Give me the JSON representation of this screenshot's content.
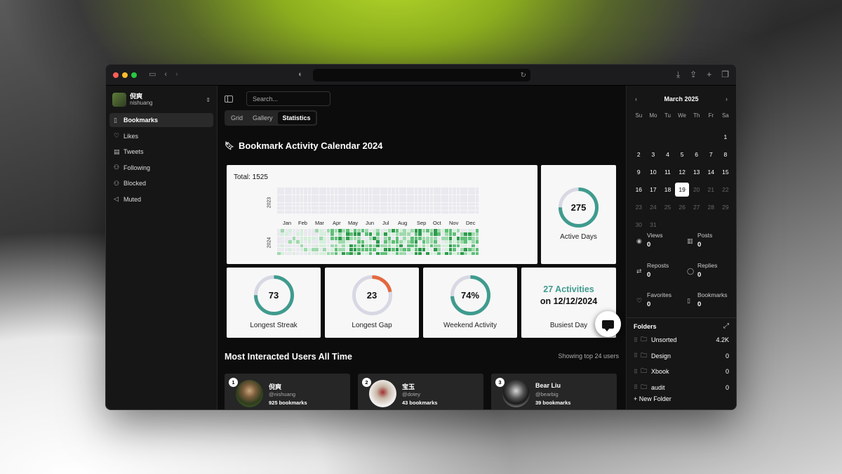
{
  "browser": {
    "address": "",
    "buttons": [
      "sidebar-toggle",
      "back",
      "forward",
      "privacy",
      "reload",
      "download",
      "share",
      "new-tab",
      "tabs-overview"
    ]
  },
  "sidebar": {
    "user": {
      "name": "倪爽",
      "handle": "nishuang"
    },
    "items": [
      {
        "label": "Bookmarks",
        "icon": "bookmark-icon",
        "active": true
      },
      {
        "label": "Likes",
        "icon": "heart-icon",
        "active": false
      },
      {
        "label": "Tweets",
        "icon": "document-icon",
        "active": false
      },
      {
        "label": "Following",
        "icon": "user-plus-icon",
        "active": false
      },
      {
        "label": "Blocked",
        "icon": "user-block-icon",
        "active": false
      },
      {
        "label": "Muted",
        "icon": "speaker-mute-icon",
        "active": false
      }
    ]
  },
  "main": {
    "search": {
      "placeholder": "Search...",
      "value": ""
    },
    "tabs": [
      {
        "label": "Grid",
        "active": false
      },
      {
        "label": "Gallery",
        "active": false
      },
      {
        "label": "Statistics",
        "active": true
      }
    ],
    "section_title": "Bookmark Activity Calendar 2024",
    "heatmap": {
      "total_label": "Total: 1525",
      "years": [
        "2023",
        "2024"
      ],
      "months": [
        "Jan",
        "Feb",
        "Mar",
        "Apr",
        "May",
        "Jun",
        "Jul",
        "Aug",
        "Sep",
        "Oct",
        "Nov",
        "Dec"
      ],
      "colors": [
        "#e9e9ef",
        "#d6efdc",
        "#9fd9ad",
        "#5fbf78",
        "#2e9a4c"
      ]
    },
    "stats": {
      "active_days": {
        "value": "275",
        "label": "Active Days",
        "fraction": 0.75,
        "color": "#3f9b8e"
      },
      "longest_streak": {
        "value": "73",
        "label": "Longest Streak",
        "fraction": 0.75,
        "color": "#3f9b8e"
      },
      "longest_gap": {
        "value": "23",
        "label": "Longest Gap",
        "fraction": 0.22,
        "color": "#e4683e"
      },
      "weekend_activity": {
        "value": "74%",
        "label": "Weekend Activity",
        "fraction": 0.74,
        "color": "#3f9b8e"
      },
      "busiest_day": {
        "count": "27 Activities",
        "date": "on 12/12/2024",
        "label": "Busiest Day",
        "accent": "#3f9b8e"
      }
    },
    "most_interacted": {
      "title": "Most Interacted Users All Time",
      "subtitle": "Showing top 24 users",
      "users": [
        {
          "rank": "1",
          "name": "倪爽",
          "handle": "@nishuang",
          "count": "925 bookmarks"
        },
        {
          "rank": "2",
          "name": "宝玉",
          "handle": "@dotey",
          "count": "43 bookmarks"
        },
        {
          "rank": "3",
          "name": "Bear Liu",
          "handle": "@bearbig",
          "count": "39 bookmarks"
        }
      ]
    }
  },
  "right_panel": {
    "calendar": {
      "month": "March 2025",
      "weekdays": [
        "Su",
        "Mo",
        "Tu",
        "We",
        "Th",
        "Fr",
        "Sa"
      ],
      "today": 19,
      "days_in_month": 31,
      "first_weekday": 6
    },
    "metrics": [
      {
        "label": "Views",
        "value": "0",
        "icon": "eye-icon"
      },
      {
        "label": "Posts",
        "value": "0",
        "icon": "bar-chart-icon"
      },
      {
        "label": "Reposts",
        "value": "0",
        "icon": "repost-icon"
      },
      {
        "label": "Replies",
        "value": "0",
        "icon": "reply-icon"
      },
      {
        "label": "Favorites",
        "value": "0",
        "icon": "heart-icon"
      },
      {
        "label": "Bookmarks",
        "value": "0",
        "icon": "bookmark-icon"
      }
    ],
    "folders_title": "Folders",
    "folders": [
      {
        "name": "Unsorted",
        "count": "4.2K"
      },
      {
        "name": "Design",
        "count": "0"
      },
      {
        "name": "Xbook",
        "count": "0"
      },
      {
        "name": "audit",
        "count": "0"
      }
    ],
    "new_folder": "+ New Folder"
  }
}
